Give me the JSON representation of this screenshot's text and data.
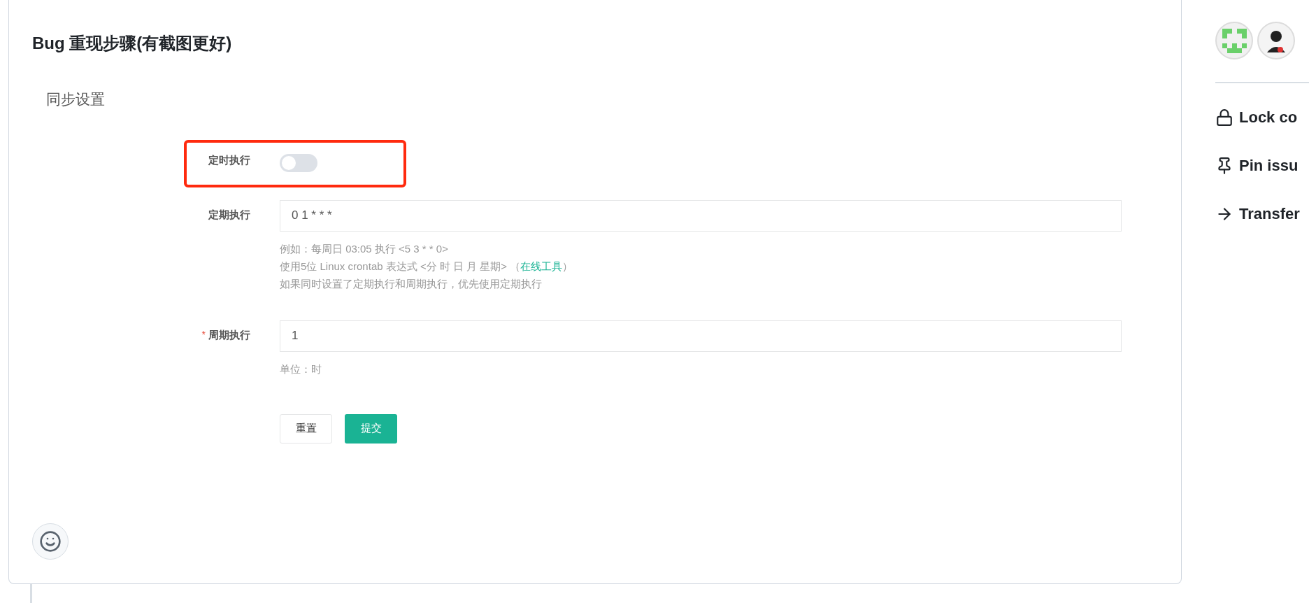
{
  "card": {
    "title": "Bug 重现步骤(有截图更好)",
    "section_title": "同步设置",
    "fields": [
      {
        "kind": "toggle",
        "label": "定时执行",
        "on": false,
        "highlighted": true
      },
      {
        "kind": "input",
        "label": "定期执行",
        "value": "0 1 * * *",
        "highlighted": false,
        "help": [
          {
            "text": "例如：每周日 03:05 执行 <5 3 * * 0>"
          },
          {
            "text": "使用5位 Linux crontab 表达式 <分 时 日 月 星期> （",
            "link": "在线工具",
            "after": "）"
          },
          {
            "text": "如果同时设置了定期执行和周期执行，优先使用定期执行"
          }
        ]
      },
      {
        "kind": "input",
        "label": "周期执行",
        "value": "1",
        "highlighted": false,
        "required_mark": "*",
        "help": [
          {
            "text": "单位：时"
          }
        ]
      }
    ],
    "buttons": [
      {
        "label": "重置",
        "kind": "secondary"
      },
      {
        "label": "提交",
        "kind": "primary"
      }
    ]
  },
  "sidebar": {
    "avatars": [
      {
        "kind": "identicon"
      },
      {
        "kind": "figure"
      }
    ],
    "actions": [
      {
        "kind": "lock",
        "label": "Lock co"
      },
      {
        "kind": "pin",
        "label": "Pin issu"
      },
      {
        "kind": "transfer",
        "label": "Transfer"
      }
    ]
  }
}
